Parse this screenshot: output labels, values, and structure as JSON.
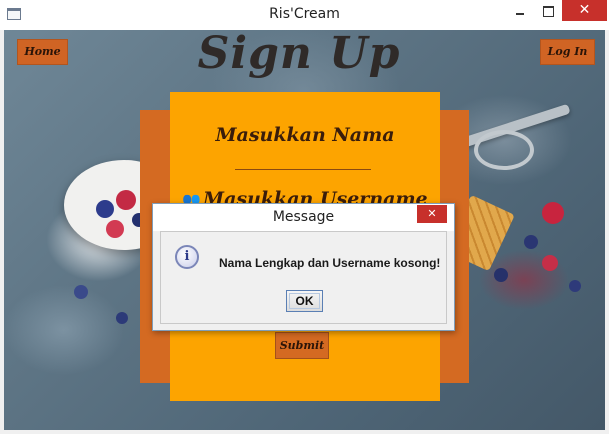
{
  "window": {
    "title": "Ris'Cream",
    "icon": "app-window-icon",
    "controls": [
      "minimize-icon",
      "maximize-icon",
      "close-icon"
    ],
    "close_glyph": "✕"
  },
  "page": {
    "heading": "Sign Up",
    "home_label": "Home",
    "login_label": "Log In"
  },
  "form": {
    "name_label": "Masukkan Nama",
    "username_label": "Masukkan Username",
    "username_icon_glyph": "👥",
    "submit_label": "Submit"
  },
  "dialog": {
    "title": "Message",
    "message": "Nama Lengkap dan Username kosong!",
    "icon": "info-icon",
    "icon_glyph": "i",
    "ok_label": "OK",
    "close_glyph": "✕"
  },
  "colors": {
    "form_panel": "#fda400",
    "form_back": "#d46a22",
    "button": "#d06424",
    "close_red": "#c7302b"
  }
}
